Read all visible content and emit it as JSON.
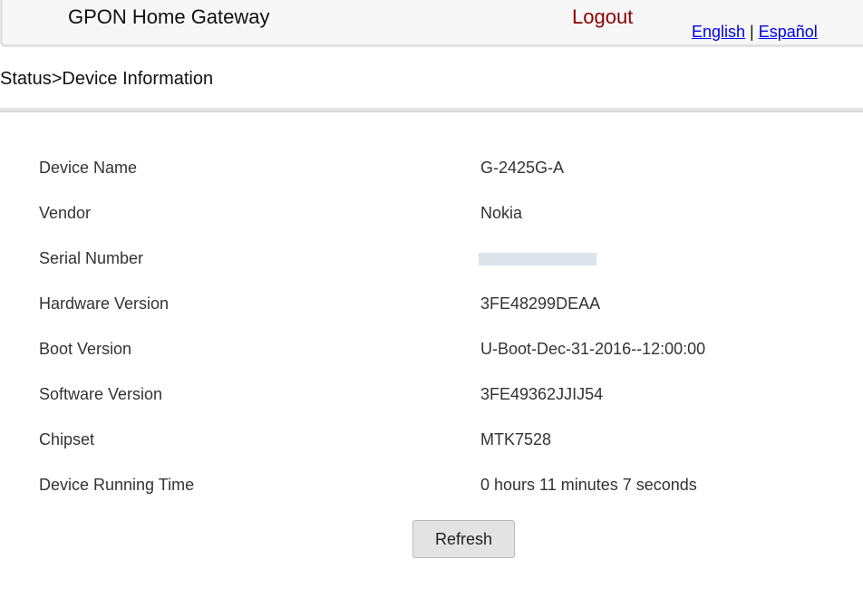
{
  "header": {
    "title": "GPON Home Gateway",
    "logout_label": "Logout",
    "languages": [
      "English",
      "Español"
    ],
    "separator": "|"
  },
  "breadcrumb": "Status>Device Information",
  "device_info": [
    {
      "label": "Device Name",
      "value": "G-2425G-A"
    },
    {
      "label": "Vendor",
      "value": "Nokia"
    },
    {
      "label": "Serial Number",
      "value": ""
    },
    {
      "label": "Hardware Version",
      "value": "3FE48299DEAA"
    },
    {
      "label": "Boot Version",
      "value": "U-Boot-Dec-31-2016--12:00:00"
    },
    {
      "label": "Software Version",
      "value": "3FE49362JJIJ54"
    },
    {
      "label": "Chipset",
      "value": "MTK7528"
    },
    {
      "label": "Device Running Time",
      "value": "0 hours 11 minutes 7 seconds"
    }
  ],
  "refresh_label": "Refresh",
  "colors": {
    "logout": "#8b0000",
    "link": "#0000ee",
    "header_border": "#e2e2e2",
    "button_bg": "#e3e3e3"
  }
}
